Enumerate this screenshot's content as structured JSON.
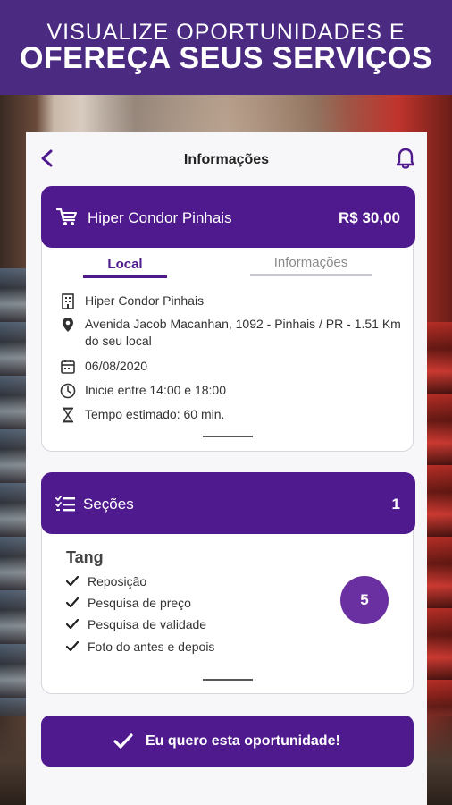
{
  "banner": {
    "line1": "VISUALIZE OPORTUNIDADES E",
    "line2": "OFEREÇA SEUS SERVIÇOS"
  },
  "header": {
    "title": "Informações",
    "back_icon": "chevron-left-icon",
    "bell_icon": "bell-icon"
  },
  "job": {
    "store": "Hiper Condor Pinhais",
    "price": "R$ 30,00",
    "tabs": [
      "Local",
      "Informações"
    ],
    "active_tab": "Local",
    "details": {
      "place": "Hiper Condor Pinhais",
      "address": "Avenida Jacob Macanhan, 1092 - Pinhais / PR - 1.51 Km do seu local",
      "date": "06/08/2020",
      "time": "Inicie entre 14:00 e 18:00",
      "duration": "Tempo estimado: 60 min."
    }
  },
  "sections": {
    "title": "Seções",
    "count": "1",
    "group": {
      "name": "Tang",
      "items": [
        "Reposição",
        "Pesquisa de preço",
        "Pesquisa de validade",
        "Foto do antes e depois"
      ],
      "total": "5"
    }
  },
  "cta": {
    "label": "Eu quero esta oportunidade!"
  },
  "colors": {
    "banner": "#4b2a82",
    "primary": "#4f1a8e",
    "badge": "#6a2fa0"
  }
}
